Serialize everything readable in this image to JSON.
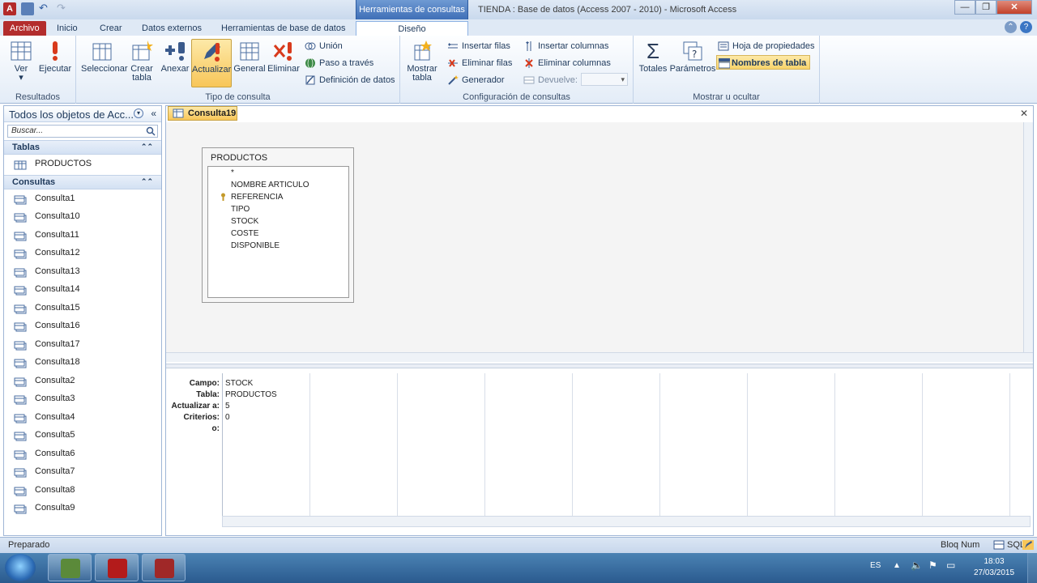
{
  "titlebar": {
    "contextual_header": "Herramientas de consultas",
    "title": "TIENDA : Base de datos (Access 2007 - 2010)  -  Microsoft Access",
    "btn_minimize": "—",
    "btn_restore": "❐",
    "btn_close": "✕"
  },
  "tabs": {
    "file": "Archivo",
    "home": "Inicio",
    "create": "Crear",
    "external": "Datos externos",
    "dbtools": "Herramientas de base de datos",
    "design": "Diseño"
  },
  "ribbon": {
    "results": {
      "label": "Resultados",
      "view": "Ver",
      "run": "Ejecutar"
    },
    "query_type": {
      "label": "Tipo de consulta",
      "select": "Seleccionar",
      "make_table": "Crear tabla",
      "append": "Anexar",
      "update": "Actualizar",
      "crosstab": "General",
      "delete": "Eliminar",
      "union": "Unión",
      "passthrough": "Paso a través",
      "data_def": "Definición de datos"
    },
    "setup": {
      "label": "Configuración de consultas",
      "show_table": "Mostrar tabla",
      "insert_rows": "Insertar filas",
      "delete_rows": "Eliminar filas",
      "builder": "Generador",
      "insert_cols": "Insertar columnas",
      "delete_cols": "Eliminar columnas",
      "returns": "Devuelve:",
      "returns_value": ""
    },
    "show_hide": {
      "label": "Mostrar u ocultar",
      "totals": "Totales",
      "params": "Parámetros",
      "prop_sheet": "Hoja de propiedades",
      "table_names": "Nombres de tabla"
    }
  },
  "nav": {
    "title": "Todos los objetos de Acc...",
    "search_placeholder": "Buscar...",
    "tables_header": "Tablas",
    "tables": [
      "PRODUCTOS"
    ],
    "queries_header": "Consultas",
    "queries": [
      "Consulta1",
      "Consulta10",
      "Consulta11",
      "Consulta12",
      "Consulta13",
      "Consulta14",
      "Consulta15",
      "Consulta16",
      "Consulta17",
      "Consulta18",
      "Consulta2",
      "Consulta3",
      "Consulta4",
      "Consulta5",
      "Consulta6",
      "Consulta7",
      "Consulta8",
      "Consulta9"
    ]
  },
  "document": {
    "tab": "Consulta19",
    "table_box": {
      "name": "PRODUCTOS",
      "fields": [
        "*",
        "NOMBRE ARTICULO",
        "REFERENCIA",
        "TIPO",
        "STOCK",
        "COSTE",
        "DISPONIBLE"
      ]
    },
    "grid": {
      "row_labels": [
        "Campo:",
        "Tabla:",
        "Actualizar a:",
        "Criterios:",
        "o:"
      ],
      "col1": {
        "field": "STOCK",
        "table": "PRODUCTOS",
        "update_to": "5",
        "criteria": "0"
      }
    }
  },
  "status": {
    "left": "Preparado",
    "right": "Bloq Num"
  },
  "taskbar": {
    "lang": "ES",
    "time": "18:03",
    "date": "27/03/2015"
  },
  "colors": {
    "accent": "#b32d2d",
    "highlight": "#f8c659",
    "ribbon_bg": "#e3ecf7"
  }
}
